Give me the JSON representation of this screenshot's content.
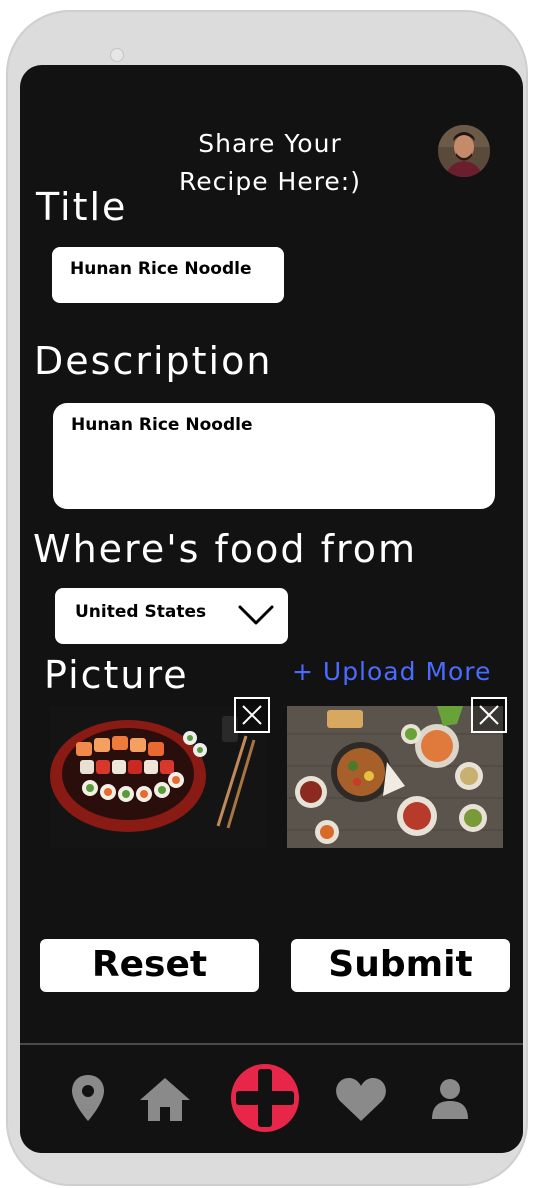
{
  "header": {
    "title_line1": "Share Your",
    "title_line2": "Recipe Here:)"
  },
  "form": {
    "title_label": "Title",
    "title_value": "Hunan Rice Noodle",
    "description_label": "Description",
    "description_value": "Hunan Rice Noodle",
    "origin_label": "Where's food from",
    "origin_value": "United States",
    "picture_label": "Picture",
    "upload_more": "+ Upload More"
  },
  "buttons": {
    "reset": "Reset",
    "submit": "Submit"
  },
  "nav": {
    "items": [
      "location-icon",
      "home-icon",
      "add-icon",
      "heart-icon",
      "profile-icon"
    ],
    "active_color": "#e8264a",
    "icon_color": "#8a8a8a"
  },
  "colors": {
    "screen_bg": "#121212",
    "link": "#4a6bff"
  }
}
